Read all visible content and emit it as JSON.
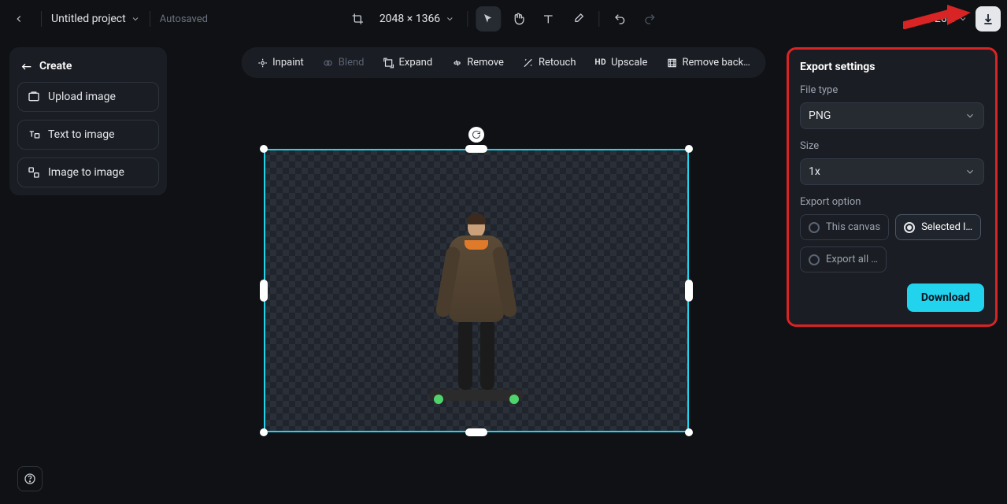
{
  "header": {
    "project_title": "Untitled project",
    "autosaved": "Autosaved",
    "canvas_dims": "2048 × 1366",
    "zoom": "26%"
  },
  "sidebar": {
    "create_label": "Create",
    "buttons": {
      "upload": "Upload image",
      "text2img": "Text to image",
      "img2img": "Image to image"
    }
  },
  "toolbar": {
    "inpaint": "Inpaint",
    "blend": "Blend",
    "expand": "Expand",
    "remove": "Remove",
    "retouch": "Retouch",
    "upscale": "Upscale",
    "removebg": "Remove back…"
  },
  "export": {
    "title": "Export settings",
    "file_type_label": "File type",
    "file_type_value": "PNG",
    "size_label": "Size",
    "size_value": "1x",
    "option_label": "Export option",
    "opt_canvas": "This canvas",
    "opt_selected": "Selected l…",
    "opt_all": "Export all …",
    "download": "Download"
  },
  "upscale_prefix": "HD"
}
